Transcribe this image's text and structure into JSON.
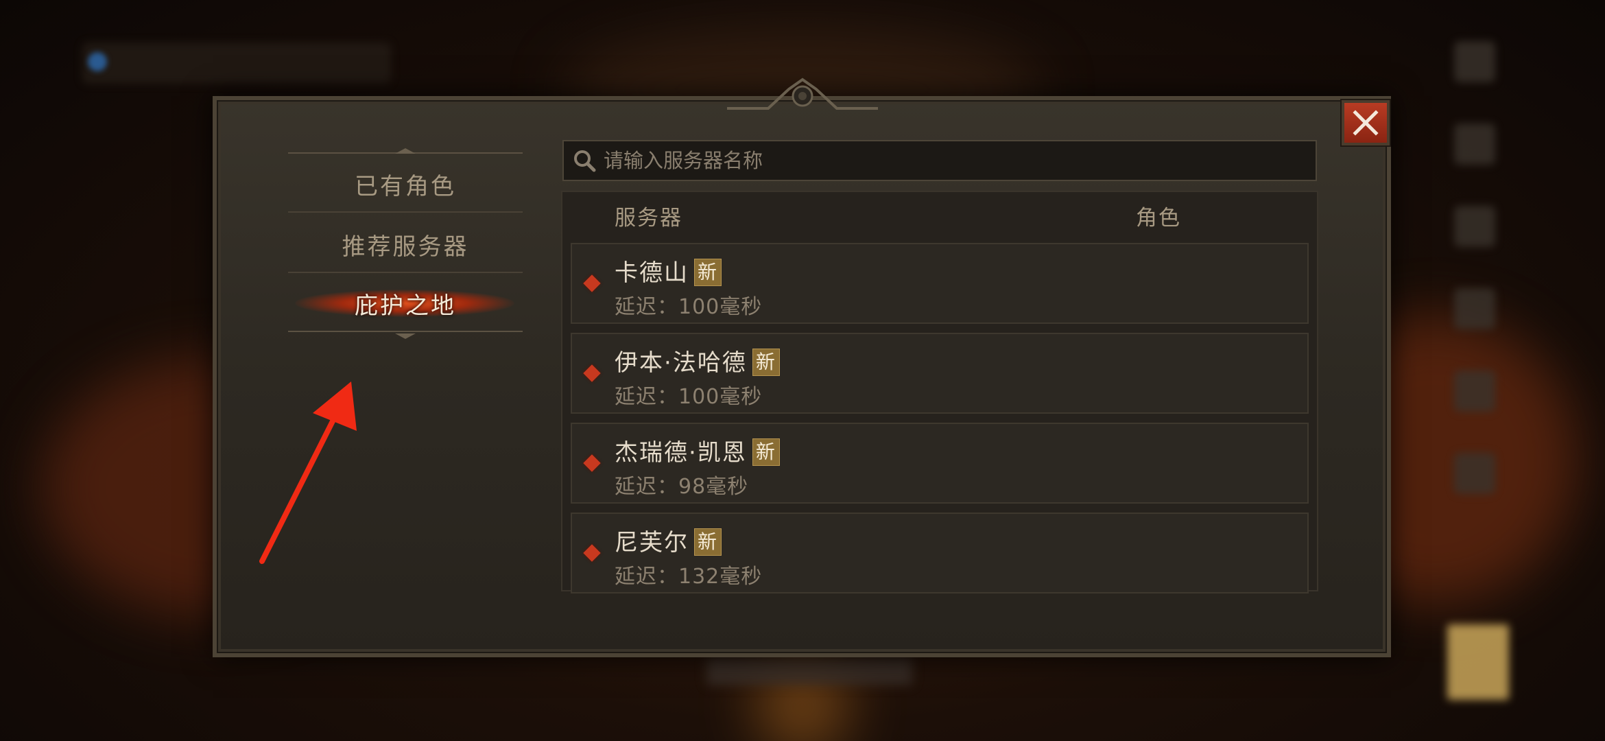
{
  "search": {
    "placeholder": "请输入服务器名称"
  },
  "nav": {
    "items": [
      {
        "label": "已有角色",
        "active": false
      },
      {
        "label": "推荐服务器",
        "active": false
      },
      {
        "label": "庇护之地",
        "active": true
      }
    ]
  },
  "table": {
    "headers": {
      "server": "服务器",
      "character": "角色"
    },
    "rows": [
      {
        "name": "卡德山",
        "badge": "新",
        "latency": "延迟：100毫秒"
      },
      {
        "name": "伊本·法哈德",
        "badge": "新",
        "latency": "延迟：100毫秒"
      },
      {
        "name": "杰瑞德·凯恩",
        "badge": "新",
        "latency": "延迟：98毫秒"
      },
      {
        "name": "尼芙尔",
        "badge": "新",
        "latency": "延迟：132毫秒"
      }
    ]
  },
  "icons": {
    "close": "close-icon",
    "search": "search-icon",
    "status": "status-diamond-icon",
    "annotation": "red-arrow-annotation"
  },
  "colors": {
    "accent_red": "#c8391f",
    "badge_gold": "#8a6d33",
    "close_red": "#a8321c",
    "annotation_red": "#f02a14"
  }
}
